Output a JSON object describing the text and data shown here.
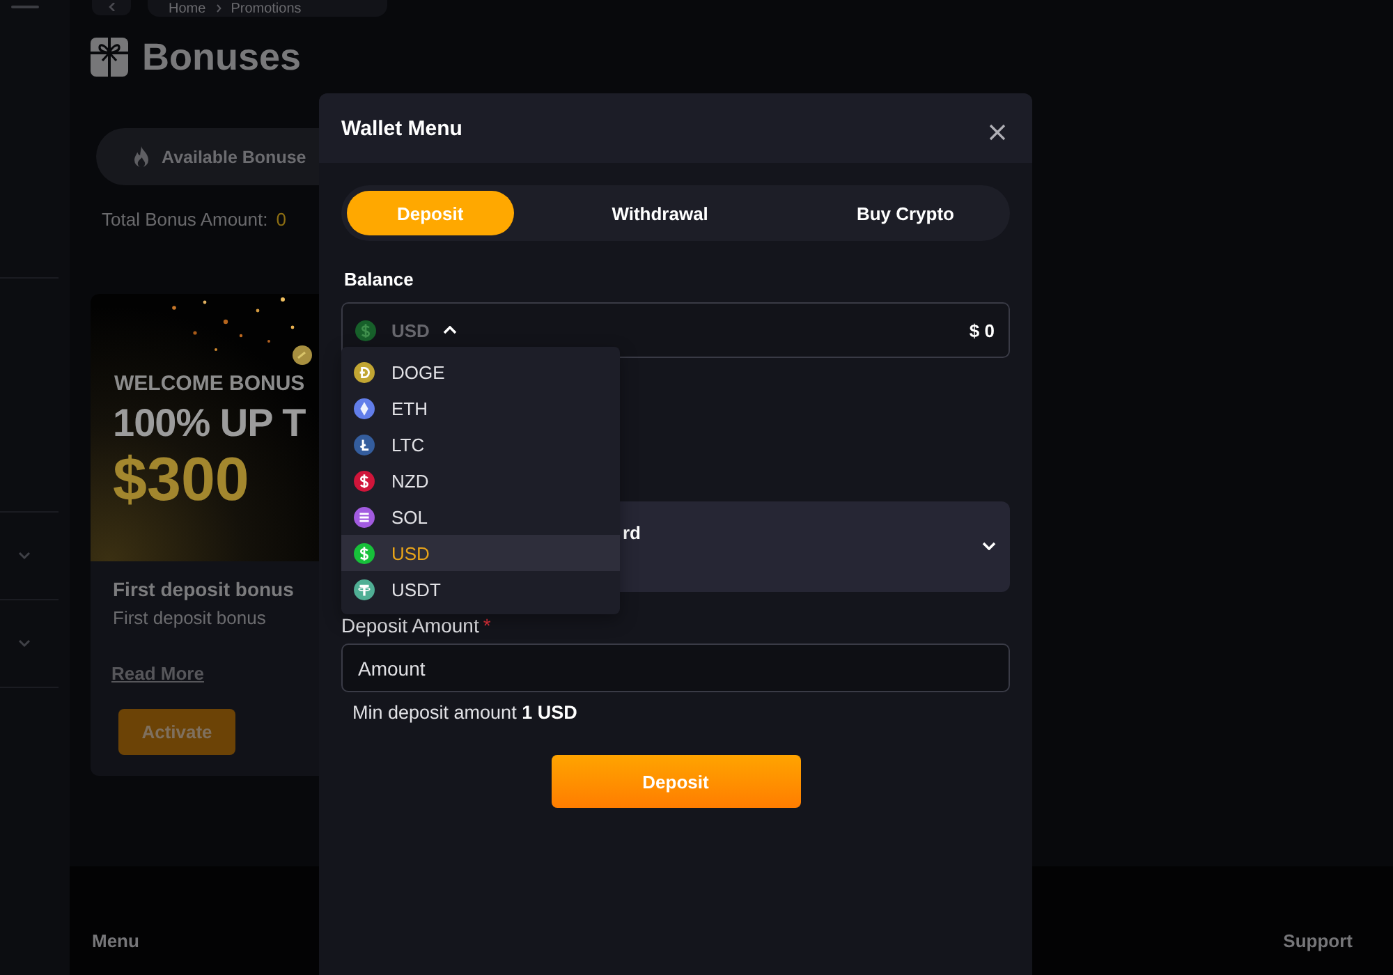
{
  "sidebar": {
    "groups": [
      {
        "expanded": false
      },
      {
        "expanded": false
      }
    ]
  },
  "breadcrumb": [
    "Home",
    "Promotions"
  ],
  "page": {
    "title": "Bonuses"
  },
  "bonus_tabs": [
    {
      "label": "Available Bonuse",
      "selected": true
    }
  ],
  "total_bonus": {
    "label": "Total Bonus Amount:",
    "value": "0"
  },
  "bonus_cards": [
    {
      "banner": [
        "WELCOME BONUS",
        "100% UP T",
        "$300"
      ],
      "title": "First deposit bonus",
      "description": "First deposit bonus",
      "link": "Read More",
      "button": "Activate"
    }
  ],
  "footer": {
    "columns": [
      "Menu",
      "Support"
    ]
  },
  "wallet_modal": {
    "title": "Wallet Menu",
    "tabs": [
      {
        "label": "Deposit",
        "selected": true
      },
      {
        "label": "Withdrawal",
        "selected": false
      },
      {
        "label": "Buy Crypto",
        "selected": false
      }
    ],
    "balance": {
      "label": "Balance",
      "currency": "USD",
      "amount": "$ 0",
      "expanded": true
    },
    "currency_options": [
      {
        "code": "DOGE",
        "kind": "dmark",
        "color": "#c2a633",
        "selected": false
      },
      {
        "code": "ETH",
        "kind": "diamond",
        "color": "#627eea",
        "selected": false
      },
      {
        "code": "LTC",
        "kind": "lmark",
        "color": "#345d9d",
        "selected": false
      },
      {
        "code": "NZD",
        "kind": "dollar",
        "color": "#d0153a",
        "selected": false
      },
      {
        "code": "SOL",
        "kind": "stripes",
        "color": "#a25be0",
        "selected": false
      },
      {
        "code": "USD",
        "kind": "dollar",
        "color": "#17c13a",
        "selected": true
      },
      {
        "code": "USDT",
        "kind": "tmark",
        "color": "#50af95",
        "selected": false
      }
    ],
    "payment_method": {
      "label": "rd"
    },
    "deposit_amount": {
      "label": "Deposit Amount",
      "required_mark": "*",
      "placeholder": "Amount"
    },
    "min_note": "Min deposit amount **1 USD**",
    "submit": "Deposit"
  }
}
